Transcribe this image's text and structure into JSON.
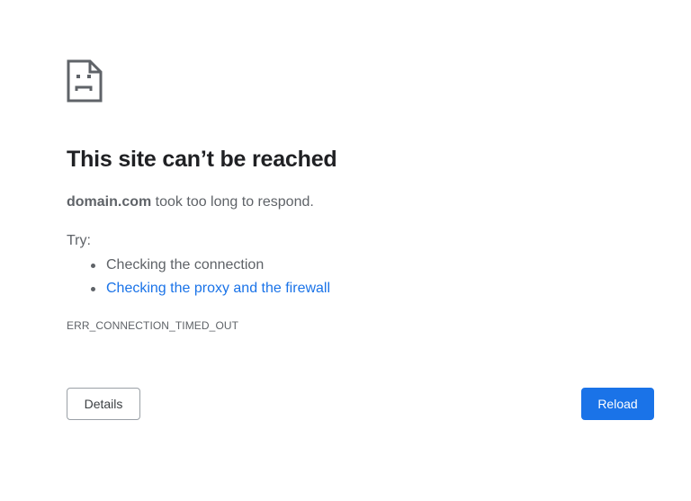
{
  "error": {
    "icon": "sad-document-icon",
    "title": "This site can’t be reached",
    "domain": "domain.com",
    "summary_text": " took too long to respond.",
    "try_label": "Try:",
    "suggestions": [
      "Checking the connection",
      "Checking the proxy and the firewall"
    ],
    "code": "ERR_CONNECTION_TIMED_OUT"
  },
  "buttons": {
    "details_label": "Details",
    "reload_label": "Reload"
  },
  "colors": {
    "title": "#202124",
    "body_text": "#5f6368",
    "link": "#1a73e8",
    "primary_button": "#1a73e8",
    "secondary_button_border": "#9aa0a6"
  }
}
